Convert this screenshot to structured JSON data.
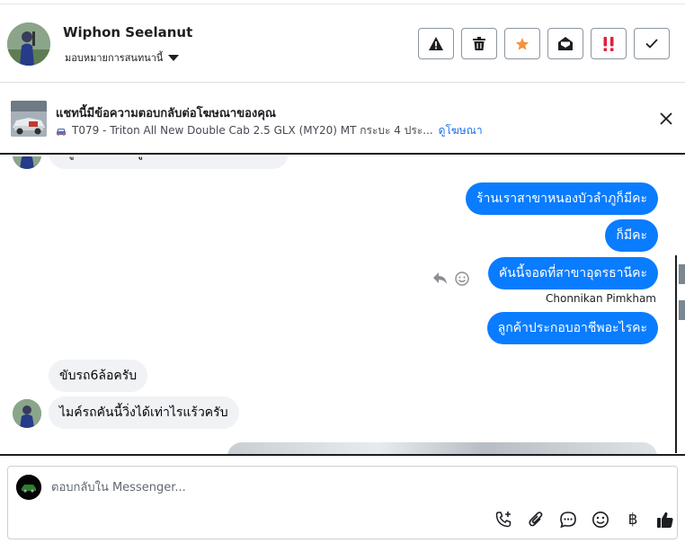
{
  "header": {
    "user_name": "Wiphon Seelanut",
    "assign_label": "มอบหมายการสนทนานี้",
    "actions": [
      {
        "name": "report-spam-button",
        "icon": "warning-icon"
      },
      {
        "name": "delete-button",
        "icon": "trash-icon"
      },
      {
        "name": "star-button",
        "icon": "star-icon"
      },
      {
        "name": "mark-unread-button",
        "icon": "envelope-open-icon"
      },
      {
        "name": "mark-important-button",
        "icon": "exclamation-icon"
      },
      {
        "name": "mark-done-button",
        "icon": "check-icon"
      }
    ],
    "star_color": "#f5923e",
    "important_color": "#e41e3f"
  },
  "ad": {
    "title": "แชทนี้มีข้อความตอบกลับต่อโฆษณาของคุณ",
    "subtitle": "T079 - Triton All New Double Cab 2.5 GLX (MY20) MT กระบะ 4 ประ...",
    "link": "ดูโฆษณา"
  },
  "messages": {
    "in_cutoff": "อยู่หนองบัวลำภูครับคันนี้ทำงานอะไรบ้าง",
    "out_1": "ร้านเราสาขาหนองบัวลำภูก็มีคะ",
    "out_2": "ก็มีคะ",
    "out_3": "คันนี้จอดที่สาขาอุดรธานีคะ",
    "sender": "Chonnikan Pimkham",
    "out_4": "ลูกค้าประกอบอาชีพอะไรคะ",
    "in_1": "ขับรถ6ล้อครับ",
    "in_2": "ไมค์รถคันนี้วิ่งได้เท่าไรแร้วครับ"
  },
  "composer": {
    "placeholder": "ตอบกลับใน Messenger..."
  },
  "colors": {
    "outgoing_bubble": "#0a7cff",
    "incoming_bubble": "#f0f2f5",
    "link": "#1a73e8"
  }
}
